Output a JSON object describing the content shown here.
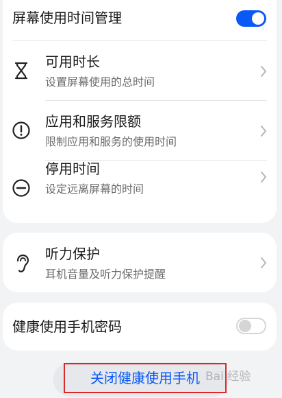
{
  "main_card": {
    "header": {
      "title": "屏幕使用时间管理",
      "toggle_on": true
    },
    "items": [
      {
        "title": "可用时长",
        "subtitle": "设置屏幕使用的总时间",
        "icon": "hourglass-icon"
      },
      {
        "title": "应用和服务限额",
        "subtitle": "限制应用和服务的使用时间",
        "icon": "exclamation-circle-icon"
      },
      {
        "title": "停用时间",
        "subtitle": "设定远离屏幕的时间",
        "icon": "minus-circle-icon"
      }
    ]
  },
  "hearing_card": {
    "title": "听力保护",
    "subtitle": "耳机音量及听力保护提醒",
    "icon": "ear-icon"
  },
  "password_card": {
    "title": "健康使用手机密码",
    "toggle_on": false
  },
  "bottom_button": {
    "label": "关闭健康使用手机"
  },
  "watermark": {
    "text": "Bai 经验"
  },
  "colors": {
    "accent": "#0a59f7",
    "highlight_box": "#d82a2a",
    "background": "#f1f3f5"
  }
}
